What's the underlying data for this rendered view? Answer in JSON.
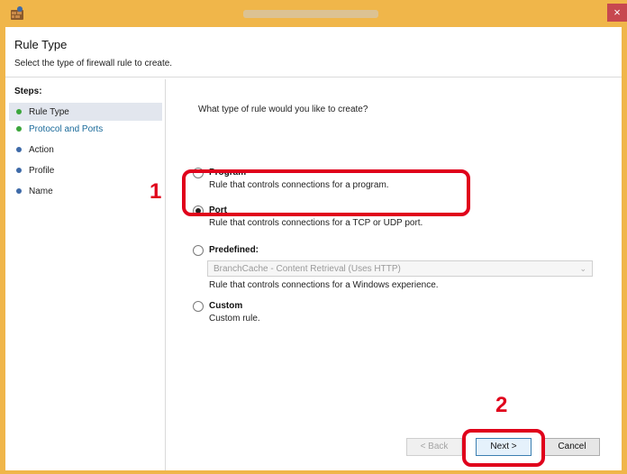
{
  "window": {
    "app_icon": "firewall-wizard-icon",
    "close_glyph": "×"
  },
  "header": {
    "title": "Rule Type",
    "subtitle": "Select the type of firewall rule to create."
  },
  "steps": {
    "title": "Steps:",
    "items": [
      {
        "label": "Rule Type",
        "state": "current"
      },
      {
        "label": "Protocol and Ports",
        "state": "link"
      },
      {
        "label": "Action",
        "state": "pending"
      },
      {
        "label": "Profile",
        "state": "pending"
      },
      {
        "label": "Name",
        "state": "pending"
      }
    ]
  },
  "content": {
    "question": "What type of rule would you like to create?",
    "options": [
      {
        "title": "Program",
        "desc": "Rule that controls connections for a program.",
        "selected": false
      },
      {
        "title": "Port",
        "desc": "Rule that controls connections for a TCP or UDP port.",
        "selected": true
      },
      {
        "title": "Predefined:",
        "desc": "Rule that controls connections for a Windows experience.",
        "selected": false
      },
      {
        "title": "Custom",
        "desc": "Custom rule.",
        "selected": false
      }
    ],
    "predefined_combo": {
      "value": "BranchCache - Content Retrieval (Uses HTTP)"
    }
  },
  "buttons": {
    "back": "< Back",
    "next": "Next >",
    "cancel": "Cancel"
  },
  "callouts": {
    "one": "1",
    "two": "2"
  },
  "colors": {
    "titlebar": "#f0b64a",
    "callout_red": "#e0001b",
    "step_green": "#3ca63c",
    "step_blue": "#3e6aa8"
  }
}
